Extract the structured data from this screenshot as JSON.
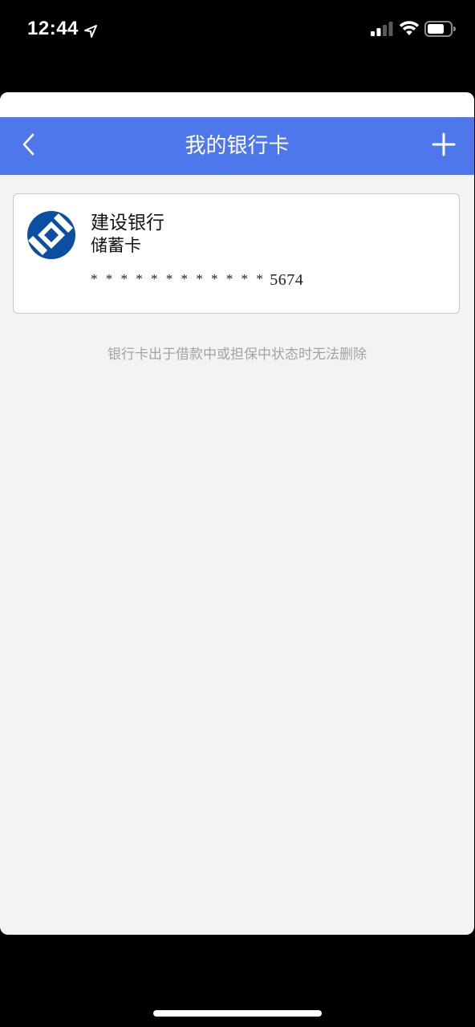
{
  "status_bar": {
    "time": "12:44",
    "location_icon": "location-arrow-icon",
    "signal_icon": "cellular-signal-icon",
    "wifi_icon": "wifi-icon",
    "battery_icon": "battery-icon"
  },
  "nav": {
    "title": "我的银行卡",
    "back_icon": "chevron-left-icon",
    "add_icon": "plus-icon",
    "background_color": "#4e77eb"
  },
  "cards": [
    {
      "bank_name": "建设银行",
      "card_type": "储蓄卡",
      "masked_digits": "* * * * * * * * * * * *",
      "last_four": "5674",
      "logo_icon": "ccb-bank-logo",
      "logo_color": "#0b4ea2"
    }
  ],
  "notice": "银行卡出于借款中或担保中状态时无法删除",
  "colors": {
    "page_background": "#f3f3f3",
    "notice_text": "#a3a3a3"
  }
}
